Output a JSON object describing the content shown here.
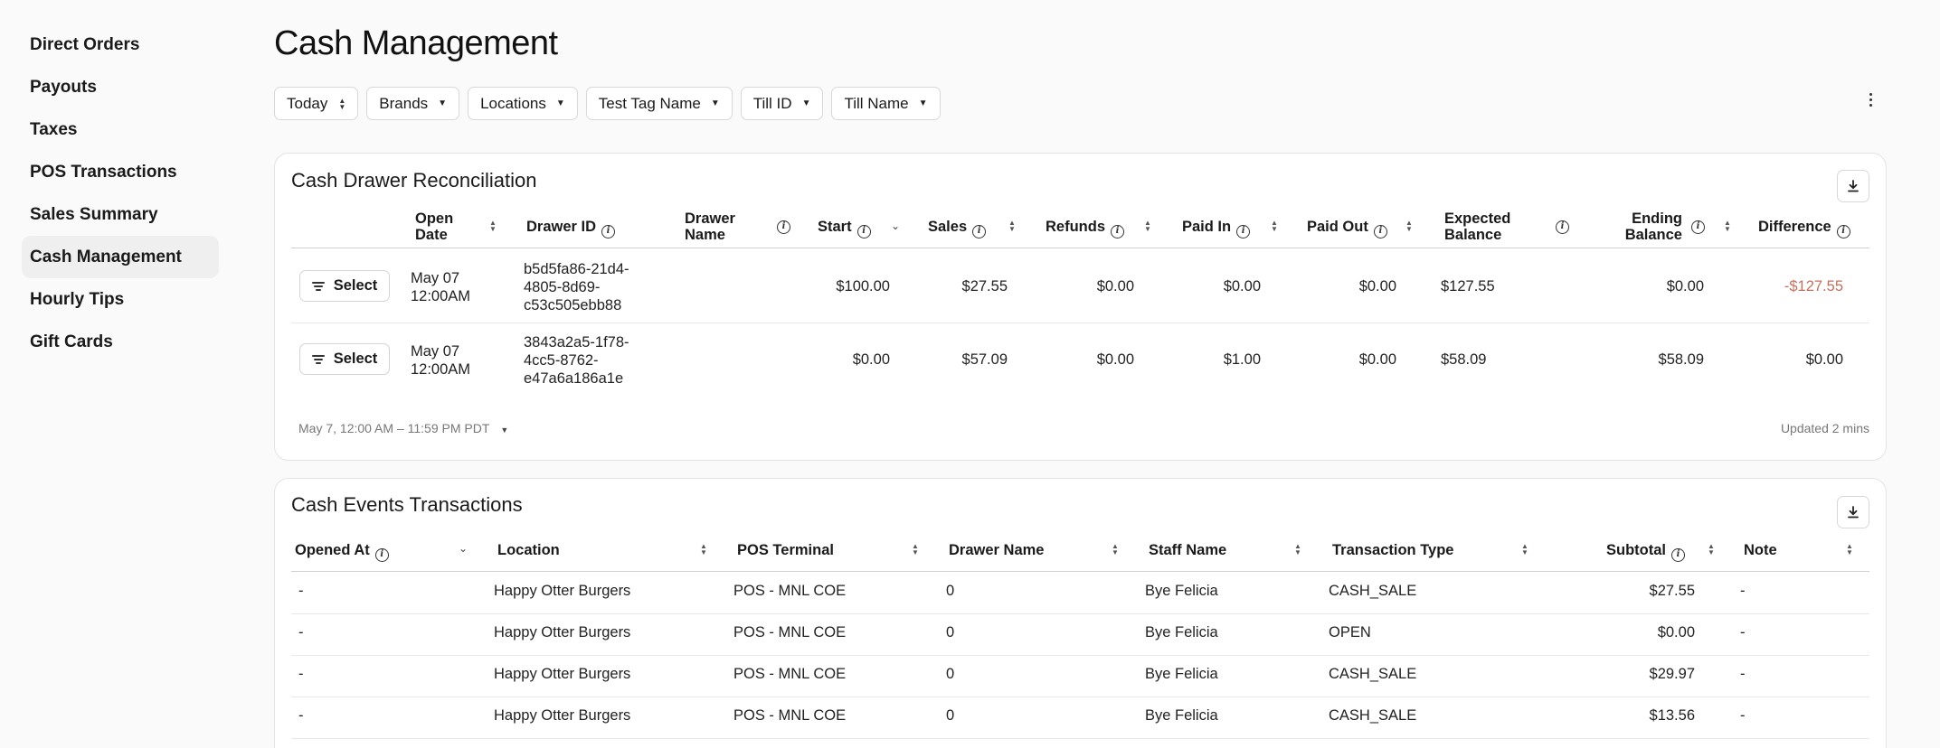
{
  "sidebar": {
    "items": [
      {
        "label": "Direct Orders"
      },
      {
        "label": "Payouts"
      },
      {
        "label": "Taxes"
      },
      {
        "label": "POS Transactions"
      },
      {
        "label": "Sales Summary"
      },
      {
        "label": "Cash Management",
        "active": true
      },
      {
        "label": "Hourly Tips"
      },
      {
        "label": "Gift Cards"
      }
    ]
  },
  "page": {
    "title": "Cash Management"
  },
  "filters": [
    {
      "label": "Today",
      "icon": "updown-icon"
    },
    {
      "label": "Brands",
      "icon": "caret-down-icon"
    },
    {
      "label": "Locations",
      "icon": "caret-down-icon"
    },
    {
      "label": "Test Tag Name",
      "icon": "caret-down-icon"
    },
    {
      "label": "Till ID",
      "icon": "caret-down-icon"
    },
    {
      "label": "Till Name",
      "icon": "caret-down-icon"
    }
  ],
  "reconciliation": {
    "title": "Cash Drawer Reconciliation",
    "headers": {
      "open_date_1": "Open",
      "open_date_2": "Date",
      "drawer_id": "Drawer ID",
      "drawer_name_1": "Drawer",
      "drawer_name_2": "Name",
      "start": "Start",
      "sales": "Sales",
      "refunds": "Refunds",
      "paid_in": "Paid In",
      "paid_out": "Paid Out",
      "expected_1": "Expected",
      "expected_2": "Balance",
      "ending_1": "Ending",
      "ending_2": "Balance",
      "difference": "Difference"
    },
    "select_label": "Select",
    "rows": [
      {
        "date_1": "May 07",
        "date_2": "12:00AM",
        "id_1": "b5d5fa86-21d4-",
        "id_2": "4805-8d69-",
        "id_3": "c53c505ebb88",
        "drawer_name": "",
        "start": "$100.00",
        "sales": "$27.55",
        "refunds": "$0.00",
        "paid_in": "$0.00",
        "paid_out": "$0.00",
        "expected": "$127.55",
        "ending": "$0.00",
        "difference": "-$127.55"
      },
      {
        "date_1": "May 07",
        "date_2": "12:00AM",
        "id_1": "3843a2a5-1f78-",
        "id_2": "4cc5-8762-",
        "id_3": "e47a6a186a1e",
        "drawer_name": "",
        "start": "$0.00",
        "sales": "$57.09",
        "refunds": "$0.00",
        "paid_in": "$1.00",
        "paid_out": "$0.00",
        "expected": "$58.09",
        "ending": "$58.09",
        "difference": "$0.00"
      }
    ],
    "date_range": "May 7, 12:00 AM – 11:59 PM PDT",
    "updated": "Updated 2 mins"
  },
  "events": {
    "title": "Cash Events Transactions",
    "headers": {
      "opened_at": "Opened At",
      "location": "Location",
      "pos_terminal": "POS Terminal",
      "drawer_name": "Drawer Name",
      "staff_name": "Staff Name",
      "transaction_type": "Transaction Type",
      "subtotal": "Subtotal",
      "note": "Note"
    },
    "rows": [
      {
        "opened_at": "-",
        "location": "Happy Otter Burgers",
        "pos": "POS - MNL COE",
        "drawer": "0",
        "staff": "Bye Felicia",
        "type": "CASH_SALE",
        "subtotal": "$27.55",
        "note": "-"
      },
      {
        "opened_at": "-",
        "location": "Happy Otter Burgers",
        "pos": "POS - MNL COE",
        "drawer": "0",
        "staff": "Bye Felicia",
        "type": "OPEN",
        "subtotal": "$0.00",
        "note": "-"
      },
      {
        "opened_at": "-",
        "location": "Happy Otter Burgers",
        "pos": "POS - MNL COE",
        "drawer": "0",
        "staff": "Bye Felicia",
        "type": "CASH_SALE",
        "subtotal": "$29.97",
        "note": "-"
      },
      {
        "opened_at": "-",
        "location": "Happy Otter Burgers",
        "pos": "POS - MNL COE",
        "drawer": "0",
        "staff": "Bye Felicia",
        "type": "CASH_SALE",
        "subtotal": "$13.56",
        "note": "-"
      }
    ]
  },
  "colors": {
    "negative": "#c0705f",
    "active_nav_bg": "#efefef"
  }
}
